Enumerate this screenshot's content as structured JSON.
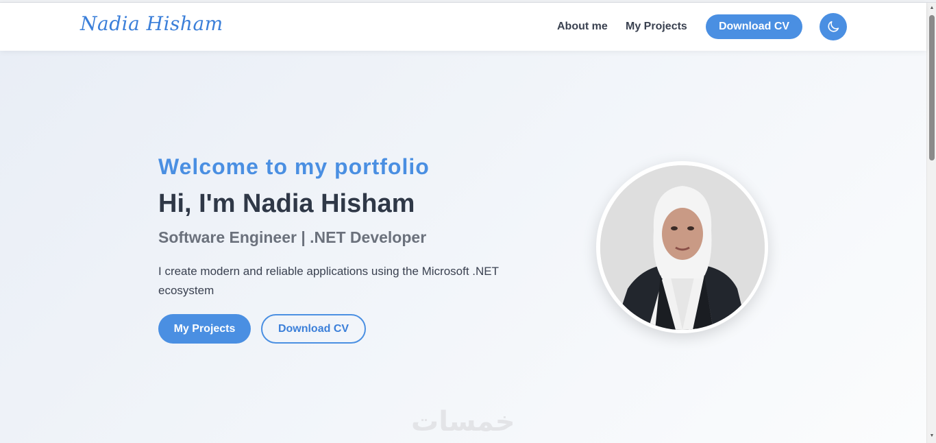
{
  "navbar": {
    "brand": "Nadia Hisham",
    "links": [
      {
        "label": "About me"
      },
      {
        "label": "My Projects"
      }
    ],
    "cv_button": "Download CV",
    "theme_icon": "moon-icon"
  },
  "hero": {
    "welcome": "Welcome to my portfolio",
    "headline": "Hi, I'm Nadia Hisham",
    "role": "Software Engineer | .NET Developer",
    "description": "I create modern and reliable applications using the Microsoft .NET ecosystem",
    "primary_button": "My Projects",
    "secondary_button": "Download CV"
  },
  "watermark": "خمسات",
  "colors": {
    "accent": "#4a8fe2",
    "heading": "#2f3847",
    "muted": "#6b717c"
  }
}
